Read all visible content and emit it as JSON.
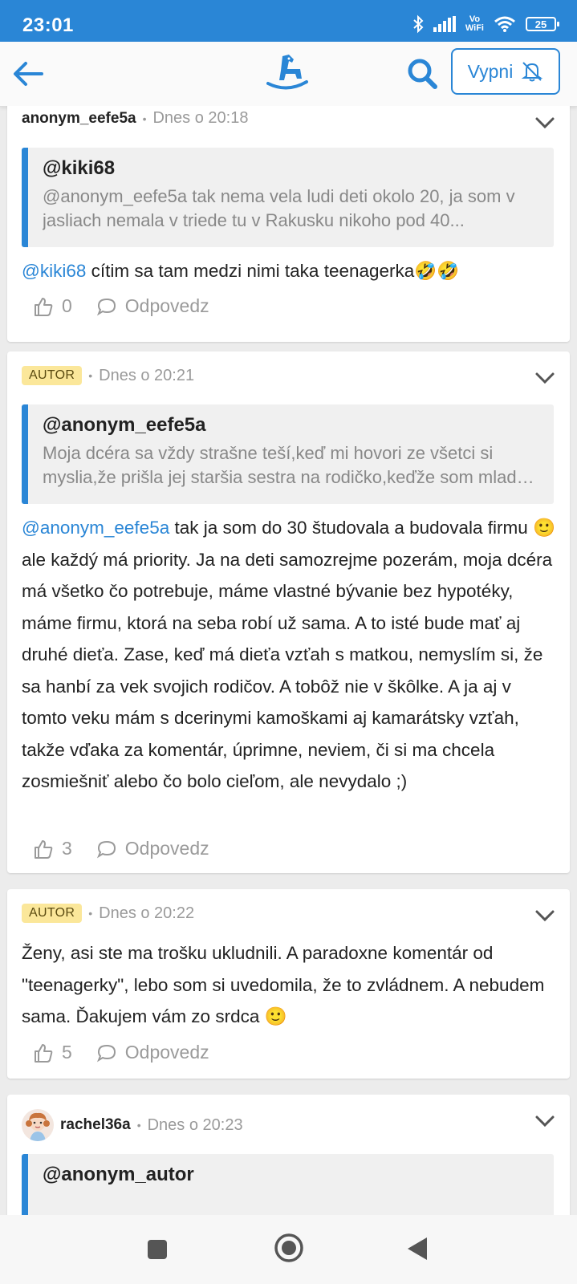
{
  "status_bar": {
    "time": "23:01",
    "vowifi_top": "Vo",
    "vowifi_bottom": "WiFi",
    "battery": "25"
  },
  "header": {
    "mute_label": "Vypni"
  },
  "comments": [
    {
      "user": "anonym_eefe5a",
      "time": "Dnes o 20:18",
      "quote_name": "@kiki68",
      "quote_text": "@anonym_eefe5a tak nema vela ludi deti okolo 20, ja som v jasliach nemala v triede tu v Rakusku nikoho pod 40...",
      "mention": "@kiki68",
      "text": " cítim sa tam medzi nimi taka teenagerka🤣🤣",
      "likes": "0",
      "reply_label": "Odpovedz"
    },
    {
      "badge": "AUTOR",
      "time": "Dnes o 20:21",
      "quote_name": "@anonym_eefe5a",
      "quote_text": "Moja dcéra sa vždy strašne teší,keď mi hovori ze všetci si myslia,že prišla jej staršia sestra na rodičko,keďže som mlada mama...",
      "mention": "@anonym_eefe5a",
      "text": " tak ja som do 30 študovala a budovala firmu 🙂 ale každý má priority. Ja na deti samozrejme pozerám, moja dcéra má všetko čo potrebuje, máme vlastné bývanie bez hypotéky, máme firmu, ktorá na seba robí už sama. A to isté bude mať aj druhé dieťa. Zase, keď má dieťa vzťah s matkou, nemyslím si, že sa hanbí za vek svojich rodičov. A tobôž nie v škôlke. A ja aj v tomto veku mám s dcerinymi kamoškami aj kamarátsky vzťah, takže vďaka za komentár, úprimne, neviem, či si ma chcela zosmiešniť alebo čo bolo cieľom, ale nevydalo ;)",
      "likes": "3",
      "reply_label": "Odpovedz"
    },
    {
      "badge": "AUTOR",
      "time": "Dnes o 20:22",
      "text": "Ženy, asi ste ma trošku ukludnili. A paradoxne komentár od \"teenagerky\", lebo som si uvedomila, že to zvládnem. A nebudem sama. Ďakujem vám zo srdca 🙂",
      "likes": "5",
      "reply_label": "Odpovedz"
    },
    {
      "user": "rachel36a",
      "time": "Dnes o 20:23",
      "quote_name": "@anonym_autor"
    }
  ],
  "colors": {
    "accent": "#2a86d6",
    "badge_bg": "#fbe79a"
  }
}
